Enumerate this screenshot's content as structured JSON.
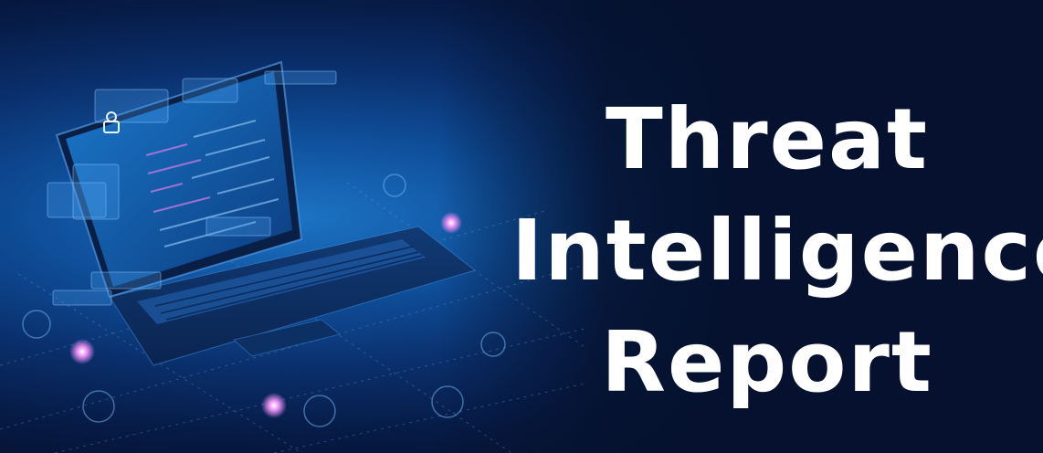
{
  "title": {
    "line1": "Threat",
    "line2": "Intelligence",
    "line3": "Report"
  },
  "colors": {
    "background": "#05112e",
    "glow": "#1c74c4",
    "text": "#ffffff"
  },
  "icons": [
    "laptop-icon",
    "user-lock-icon",
    "cloud-icon",
    "gear-icon",
    "settings-icon",
    "chart-icon"
  ]
}
